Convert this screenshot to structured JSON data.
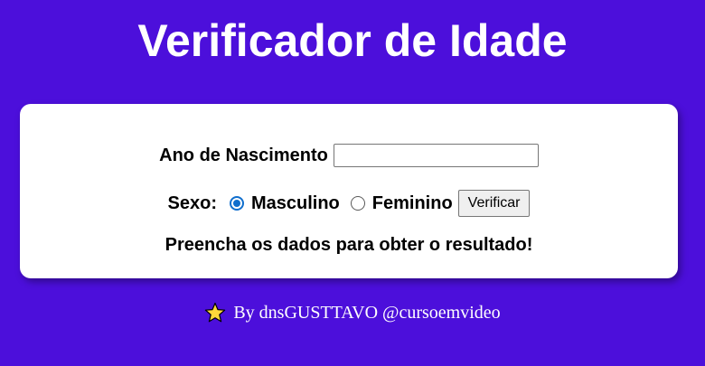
{
  "header": {
    "title": "Verificador de Idade"
  },
  "form": {
    "birth_year_label": "Ano de Nascimento",
    "birth_year_value": "",
    "sex_label": "Sexo:",
    "options": [
      {
        "label": "Masculino",
        "checked": true
      },
      {
        "label": "Feminino",
        "checked": false
      }
    ],
    "verify_button_label": "Verificar"
  },
  "result": {
    "text": "Preencha os dados para obter o resultado!"
  },
  "footer": {
    "icon": "star-icon",
    "text": "By dnsGUSTTAVO @cursoemvideo"
  },
  "colors": {
    "background": "#4c0fdb",
    "card": "#ffffff",
    "radio_accent": "#0f6ecd",
    "star": "#ffd83b"
  }
}
